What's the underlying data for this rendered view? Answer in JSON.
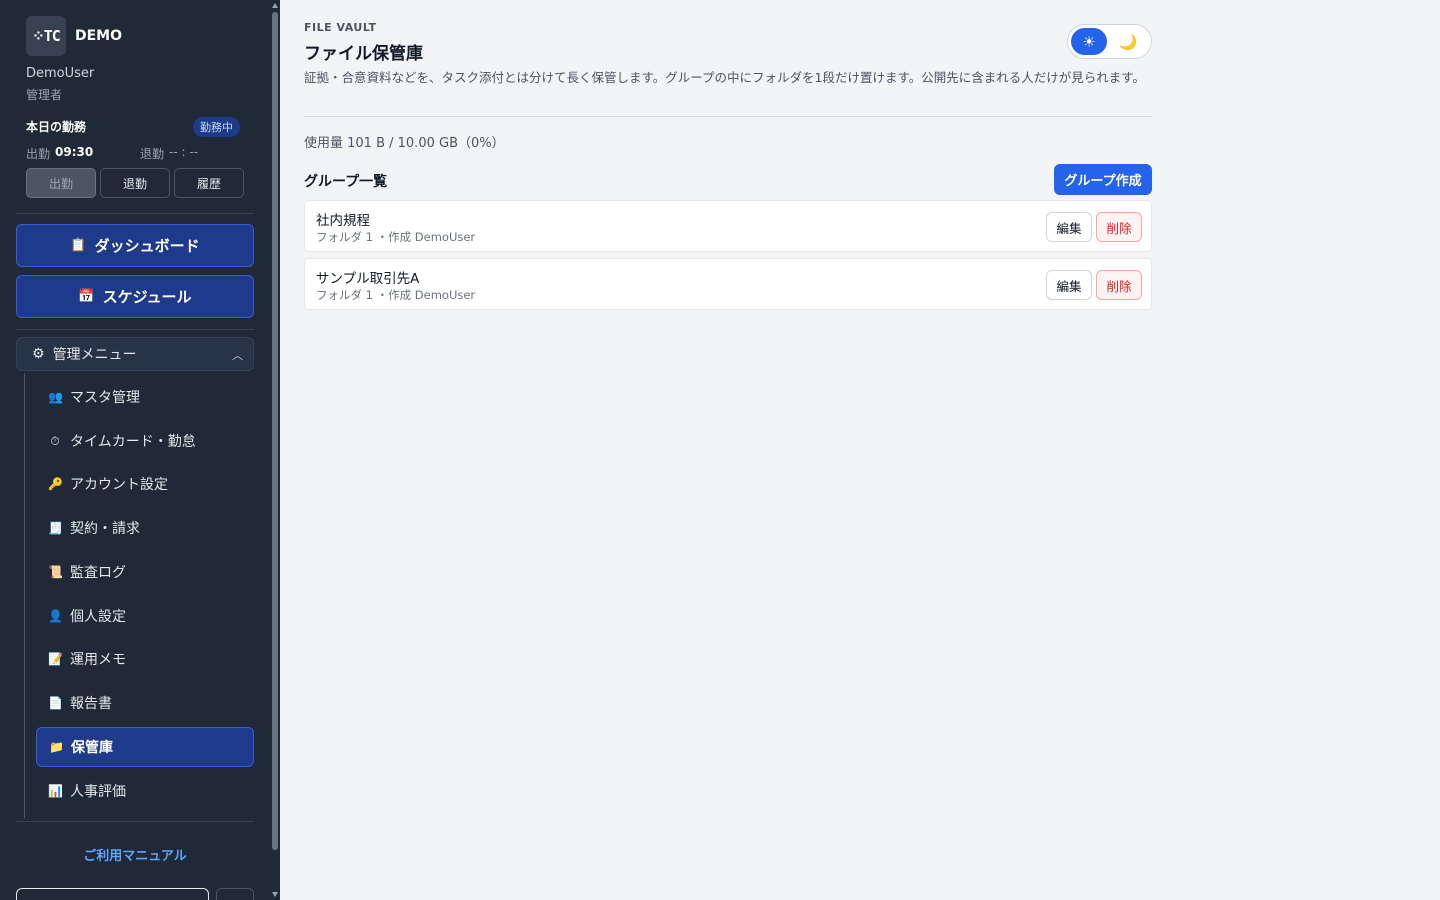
{
  "sidebar": {
    "logo_text": "⁘TC",
    "brand": "DEMO",
    "user_name": "DemoUser",
    "user_role": "管理者",
    "attendance": {
      "title": "本日の勤務",
      "status_badge": "勤務中",
      "in_label": "出勤",
      "in_time": "09:30",
      "out_label": "退勤",
      "out_time": "-- : --",
      "buttons": [
        "出勤",
        "退勤",
        "履歴"
      ]
    },
    "nav_main": [
      {
        "icon": "clipboard-icon",
        "glyph": "📋",
        "label": "ダッシュボード"
      },
      {
        "icon": "calendar-icon",
        "glyph": "📅",
        "label": "スケジュール"
      }
    ],
    "admin_menu": {
      "icon": "gear-icon",
      "glyph": "⚙",
      "label": "管理メニュー",
      "items": [
        {
          "icon": "users-icon",
          "glyph": "👥",
          "label": "マスタ管理"
        },
        {
          "icon": "stopwatch-icon",
          "glyph": "⏱",
          "label": "タイムカード・勤怠"
        },
        {
          "icon": "key-icon",
          "glyph": "🔑",
          "label": "アカウント設定"
        },
        {
          "icon": "receipt-icon",
          "glyph": "🧾",
          "label": "契約・請求"
        },
        {
          "icon": "scroll-icon",
          "glyph": "📜",
          "label": "監査ログ"
        },
        {
          "icon": "person-icon",
          "glyph": "👤",
          "label": "個人設定"
        },
        {
          "icon": "memo-icon",
          "glyph": "📝",
          "label": "運用メモ"
        },
        {
          "icon": "document-icon",
          "glyph": "📄",
          "label": "報告書"
        },
        {
          "icon": "folder-icon",
          "glyph": "📁",
          "label": "保管庫",
          "active": true
        },
        {
          "icon": "bar-chart-icon",
          "glyph": "📊",
          "label": "人事評価"
        }
      ]
    },
    "manual_link": "ご利用マニュアル"
  },
  "main": {
    "eyebrow": "FILE VAULT",
    "title": "ファイル保管庫",
    "description": "証拠・合意資料などを、タスク添付とは分けて長く保管します。グループの中にフォルダを1段だけ置けます。公開先に含まれる人だけが見られます。",
    "theme": {
      "light_icon": "☀",
      "dark_icon": "🌙"
    },
    "usage": "使用量 101 B / 10.00 GB（0%）",
    "section_title": "グループ一覧",
    "create_button": "グループ作成",
    "groups": [
      {
        "name": "社内規程",
        "meta": "フォルダ 1 ・作成 DemoUser",
        "edit": "編集",
        "delete": "削除"
      },
      {
        "name": "サンプル取引先A",
        "meta": "フォルダ 1 ・作成 DemoUser",
        "edit": "編集",
        "delete": "削除"
      }
    ]
  },
  "colors": {
    "sidebar_bg": "#1f2937",
    "accent": "#2563eb",
    "active_nav": "#1e3a8a",
    "danger": "#dc2626"
  }
}
